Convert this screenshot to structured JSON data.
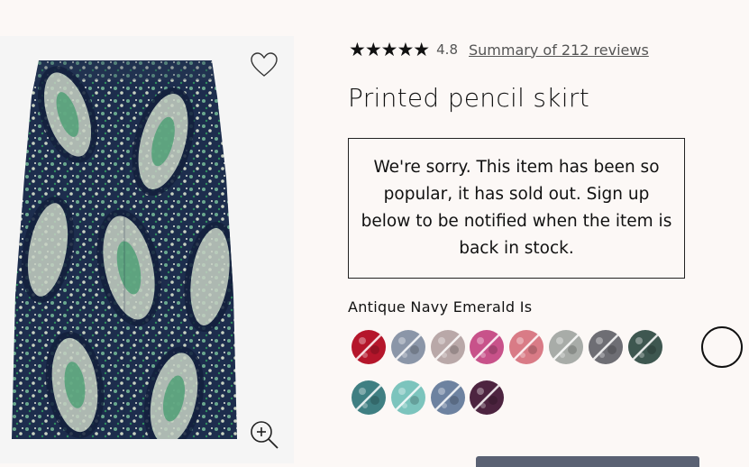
{
  "product": {
    "title": "Printed pencil skirt",
    "rating": {
      "stars": "★★★★★",
      "value": 4.8,
      "value_text": "4.8",
      "reviews_link": "Summary of 212 reviews"
    },
    "sold_out_message": "We're sorry. This item has been so popular, it has sold out. Sign up below to be notified when the item is back in stock.",
    "selected_color": "Antique Navy Emerald Is",
    "swatches": [
      {
        "name": "red-plaid",
        "color": "#b5162b",
        "available": false
      },
      {
        "name": "grey-blue",
        "color": "#8b96a8",
        "available": false
      },
      {
        "name": "multi-floral",
        "color": "#b9a8a8",
        "available": false
      },
      {
        "name": "pink-green-floral",
        "color": "#c8528a",
        "available": false
      },
      {
        "name": "pink-dots",
        "color": "#d97b86",
        "available": false
      },
      {
        "name": "grey-paisley",
        "color": "#a8aca8",
        "available": false
      },
      {
        "name": "black-white-print",
        "color": "#6e6e74",
        "available": false
      },
      {
        "name": "antique-navy-emerald",
        "color": "#3e5750",
        "available": false,
        "selected": true
      },
      {
        "name": "teal-floral",
        "color": "#3f7f82",
        "available": false
      },
      {
        "name": "mint",
        "color": "#7cc4bd",
        "available": false
      },
      {
        "name": "blue-multi",
        "color": "#6d82a0",
        "available": false
      },
      {
        "name": "purple-dots",
        "color": "#4d2440",
        "available": false
      }
    ]
  },
  "icons": {
    "wishlist": "heart-icon",
    "zoom": "zoom-in-icon"
  },
  "colors": {
    "page_bg": "#fcf8f6",
    "image_bg": "#f5f5f5",
    "cta": "#5a6173"
  }
}
